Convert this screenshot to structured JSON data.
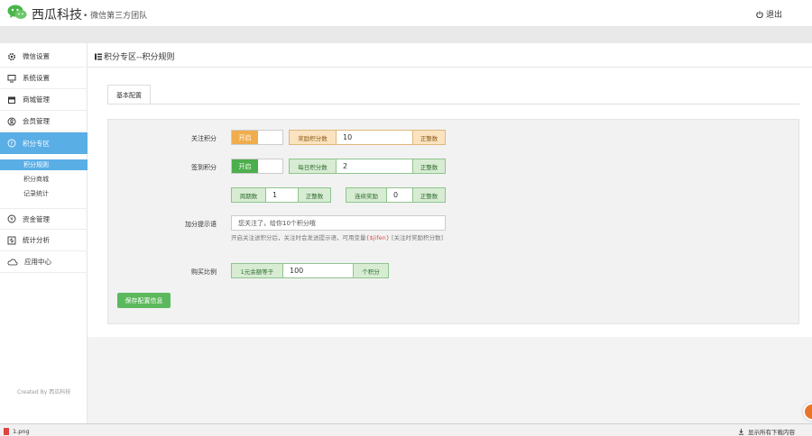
{
  "header": {
    "brand": "西瓜科技",
    "subtitle": "• 微信第三方团队",
    "logout_label": "退出"
  },
  "sidebar": {
    "items": [
      {
        "label": "微信设置",
        "icon": "gear-icon"
      },
      {
        "label": "系统设置",
        "icon": "monitor-icon"
      },
      {
        "label": "商城管理",
        "icon": "store-icon"
      },
      {
        "label": "会员管理",
        "icon": "user-icon"
      },
      {
        "label": "积分专区",
        "icon": "coin-icon",
        "active": true
      },
      {
        "label": "资金管理",
        "icon": "yen-icon"
      },
      {
        "label": "统计分析",
        "icon": "stats-icon"
      },
      {
        "label": "应用中心",
        "icon": "cloud-icon"
      }
    ],
    "subitems": [
      {
        "label": "积分规则",
        "active": true
      },
      {
        "label": "积分商城"
      },
      {
        "label": "记录统计"
      }
    ],
    "credit": "Created By 西瓜科技"
  },
  "page": {
    "title": "积分专区--积分规则",
    "tab_label": "基本配置"
  },
  "form": {
    "follow": {
      "label": "关注积分",
      "toggle_on": "开启",
      "prefix": "奖励积分数",
      "value": "10",
      "suffix": "正整数"
    },
    "checkin": {
      "label": "签到积分",
      "toggle_on": "开启",
      "prefix": "每日积分数",
      "value": "2",
      "suffix": "正整数"
    },
    "cycle": {
      "prefix": "周期数",
      "value": "1",
      "suffix": "正整数"
    },
    "streak": {
      "prefix": "连续奖励",
      "value": "0",
      "suffix": "正整数"
    },
    "prompt": {
      "label": "加分提示语",
      "value": "您关注了，给你10个积分哦",
      "help_before": "开启关注送积分后，关注时会发送提示语，可用变量",
      "help_var": "{$jifen}",
      "help_after": " [关注时奖励积分数]"
    },
    "ratio": {
      "label": "购买比例",
      "prefix": "1元余额等于",
      "value": "100",
      "suffix": "个积分"
    },
    "save_label": "保存配置信息"
  },
  "downloads": {
    "file_label": "1.png",
    "show_all_label": "显示所有下载内容"
  },
  "colors": {
    "accent_blue": "#5aaee6",
    "orange": "#f0ad4e",
    "green": "#4cae4c",
    "save_green": "#5cb85c"
  }
}
